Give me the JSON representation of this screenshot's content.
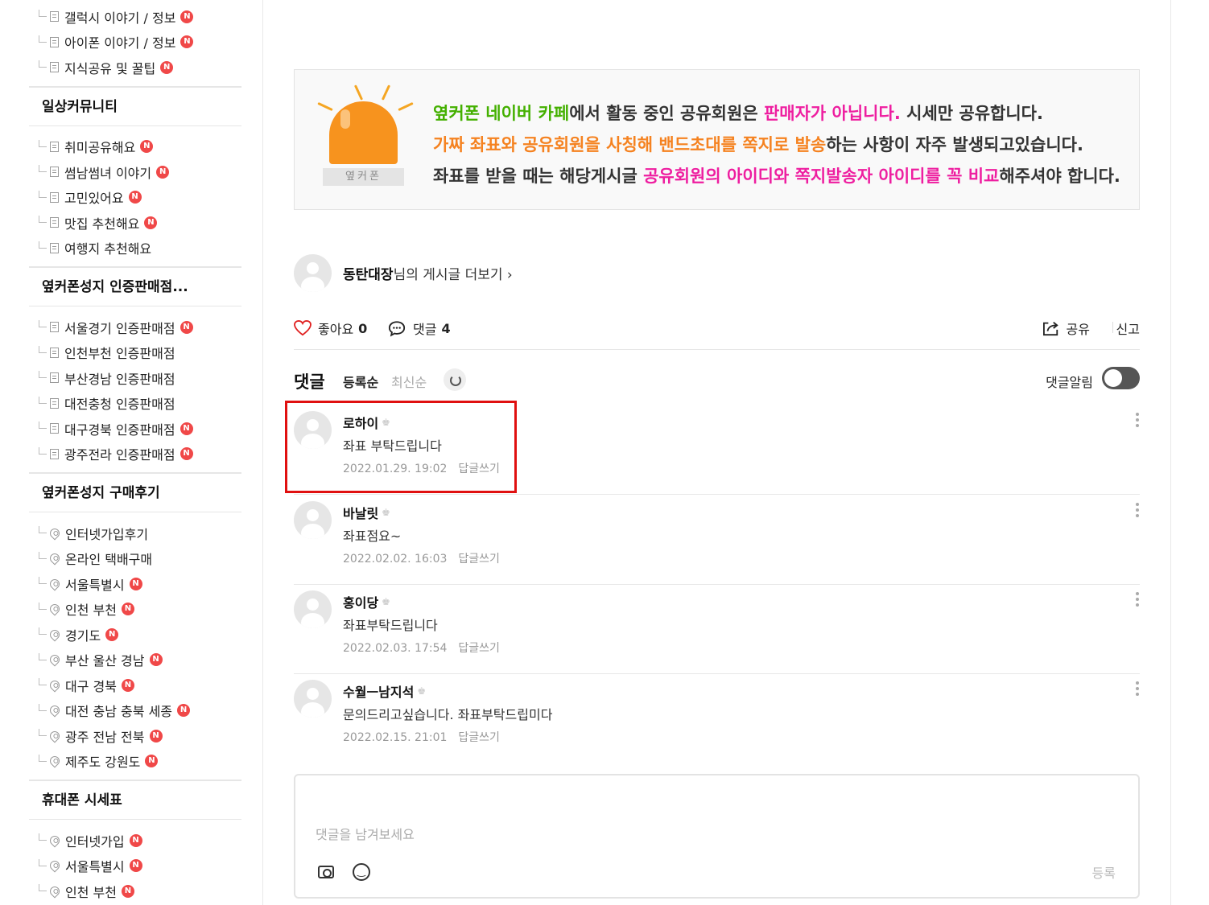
{
  "sidebar": {
    "top_items": [
      {
        "label": "갤럭시 이야기 / 정보",
        "icon": "doc",
        "new": true
      },
      {
        "label": "아이폰 이야기 / 정보",
        "icon": "doc",
        "new": true
      },
      {
        "label": "지식공유 및 꿀팁",
        "icon": "doc",
        "new": true
      }
    ],
    "groups": [
      {
        "title": "일상커뮤니티",
        "items": [
          {
            "label": "취미공유해요",
            "icon": "doc",
            "new": true
          },
          {
            "label": "썸남썸녀 이야기",
            "icon": "doc",
            "new": true
          },
          {
            "label": "고민있어요",
            "icon": "doc",
            "new": true
          },
          {
            "label": "맛집 추천해요",
            "icon": "doc",
            "new": true
          },
          {
            "label": "여행지 추천해요",
            "icon": "doc",
            "new": false
          }
        ]
      },
      {
        "title": "옆커폰성지 인증판매점...",
        "items": [
          {
            "label": "서울경기 인증판매점",
            "icon": "doc",
            "new": true
          },
          {
            "label": "인천부천 인증판매점",
            "icon": "doc",
            "new": false
          },
          {
            "label": "부산경남 인증판매점",
            "icon": "doc",
            "new": false
          },
          {
            "label": "대전충청 인증판매점",
            "icon": "doc",
            "new": false
          },
          {
            "label": "대구경북 인증판매점",
            "icon": "doc",
            "new": true
          },
          {
            "label": "광주전라 인증판매점",
            "icon": "doc",
            "new": true
          }
        ]
      },
      {
        "title": "옆커폰성지 구매후기",
        "items": [
          {
            "label": "인터넷가입후기",
            "icon": "pin",
            "new": false
          },
          {
            "label": "온라인 택배구매",
            "icon": "pin",
            "new": false
          },
          {
            "label": "서울특별시",
            "icon": "pin",
            "new": true
          },
          {
            "label": "인천 부천",
            "icon": "pin",
            "new": true
          },
          {
            "label": "경기도",
            "icon": "pin",
            "new": true
          },
          {
            "label": "부산 울산 경남",
            "icon": "pin",
            "new": true
          },
          {
            "label": "대구 경북",
            "icon": "pin",
            "new": true
          },
          {
            "label": "대전 충남 충북 세종",
            "icon": "pin",
            "new": true
          },
          {
            "label": "광주 전남 전북",
            "icon": "pin",
            "new": true
          },
          {
            "label": "제주도 강원도",
            "icon": "pin",
            "new": true
          }
        ]
      },
      {
        "title": "휴대폰 시세표",
        "items": [
          {
            "label": "인터넷가입",
            "icon": "pin",
            "new": true
          },
          {
            "label": "서울특별시",
            "icon": "pin",
            "new": true
          },
          {
            "label": "인천 부천",
            "icon": "pin",
            "new": true
          }
        ]
      }
    ],
    "new_badge": "N"
  },
  "notice": {
    "siren_label": "옆커폰",
    "line1": [
      {
        "t": "옆커폰 네이버 카페",
        "c": "green"
      },
      {
        "t": "에서 활동 중인 공유회원은 ",
        "c": ""
      },
      {
        "t": "판매자가 아닙니다.",
        "c": "magenta"
      },
      {
        "t": " 시세만 공유합니다.",
        "c": ""
      }
    ],
    "line2": [
      {
        "t": "가짜 좌표와 공유회원을 사칭해 밴드초대를 쪽지로 발송",
        "c": "orange"
      },
      {
        "t": "하는 사항이 자주 발생되고있습니다.",
        "c": ""
      }
    ],
    "line3": [
      {
        "t": "좌표를 받을 때는 해당게시글 ",
        "c": ""
      },
      {
        "t": "공유회원의 아이디와 쪽지발송자 아이디를 꼭 비교",
        "c": "magenta"
      },
      {
        "t": "해주셔야 합니다.",
        "c": ""
      }
    ]
  },
  "author": {
    "name": "동탄대장",
    "suffix": "님의 게시글 더보기 ›"
  },
  "stats": {
    "like_label": "좋아요",
    "like_count": "0",
    "comment_label": "댓글",
    "comment_count": "4",
    "share_label": "공유",
    "report_label": "신고"
  },
  "comments_header": {
    "title": "댓글",
    "sort_registered": "등록순",
    "sort_latest": "최신순",
    "alarm_label": "댓글알림"
  },
  "comments": [
    {
      "nick": "로하이",
      "text": "좌표 부탁드립니다",
      "date": "2022.01.29. 19:02",
      "reply": "답글쓰기"
    },
    {
      "nick": "바날릿",
      "text": "좌표점요~",
      "date": "2022.02.02. 16:03",
      "reply": "답글쓰기"
    },
    {
      "nick": "홍이당",
      "text": "좌표부탁드립니다",
      "date": "2022.02.03. 17:54",
      "reply": "답글쓰기"
    },
    {
      "nick": "수월ㅡ남지석",
      "text": "문의드리고싶습니다. 좌표부탁드립미다",
      "date": "2022.02.15. 21:01",
      "reply": "답글쓰기"
    }
  ],
  "write": {
    "placeholder": "댓글을 남겨보세요",
    "submit": "등록"
  },
  "colors": {
    "new_badge": "#f04848",
    "highlight": "#e01010",
    "green": "#44b000",
    "magenta": "#ee1ea0",
    "orange": "#f58220"
  }
}
